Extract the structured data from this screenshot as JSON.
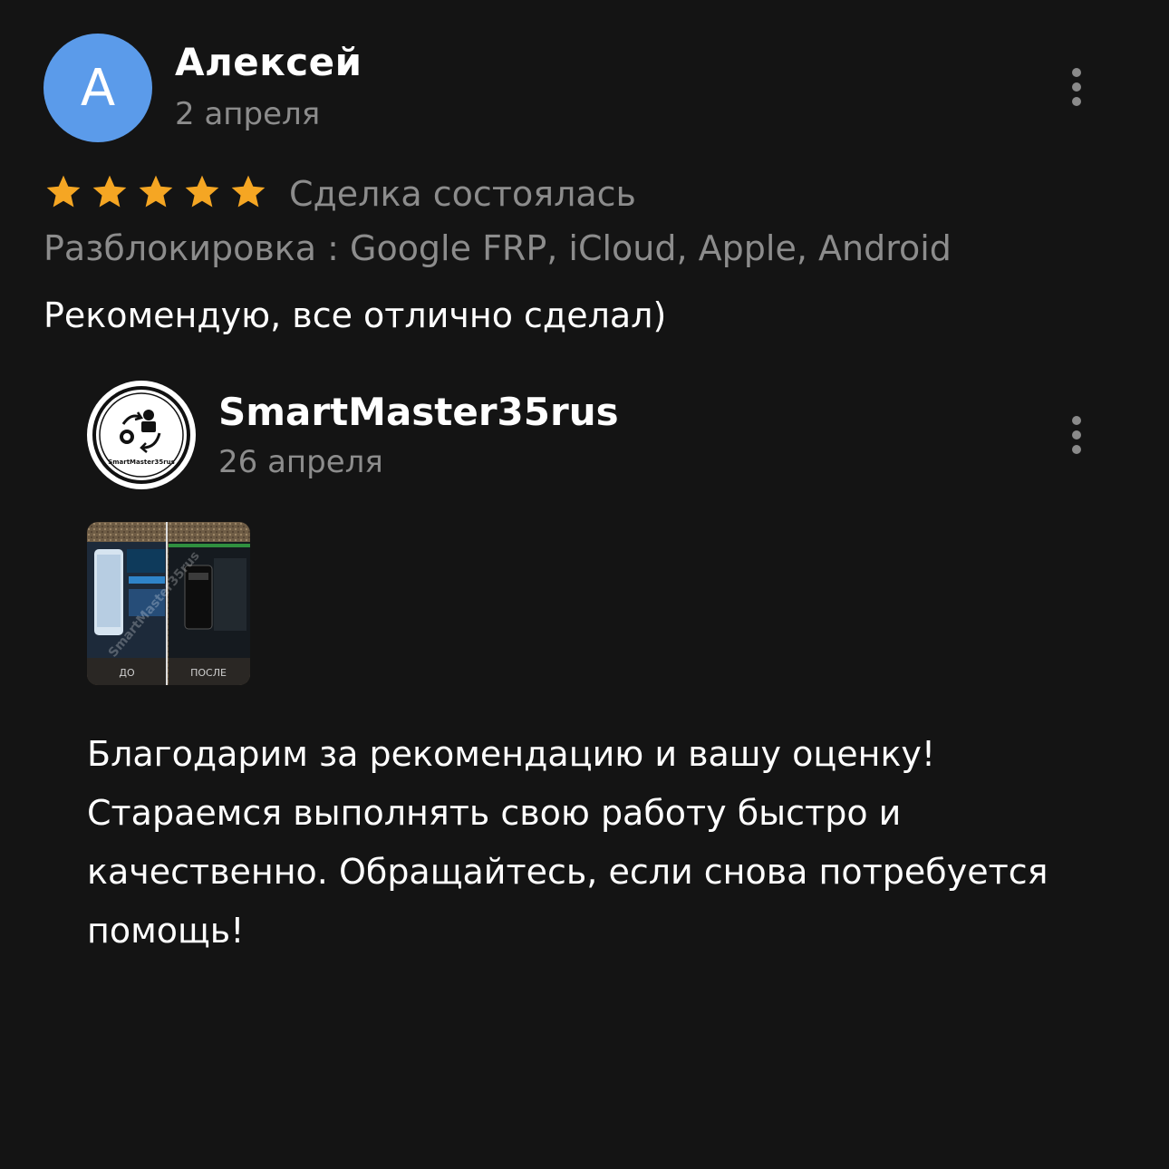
{
  "review": {
    "avatar_letter": "А",
    "author": "Алексей",
    "date": "2 апреля",
    "rating": 5,
    "rating_max": 5,
    "star_color": "#f5a623",
    "deal_status": "Сделка состоялась",
    "service": "Разблокировка : Google FRP, iCloud, Apple, Android",
    "text": "Рекомендую, все отлично сделал)",
    "menu_icon": "more-vertical-icon"
  },
  "reply": {
    "author": "SmartMaster35rus",
    "date": "26 апреля",
    "logo_text": "SmartMaster35rus",
    "photo_captions": [
      "ДО",
      "ПОСЛЕ"
    ],
    "text": "Благодарим за рекомендацию и вашу оценку! Стараемся выполнять свою работу быстро и качественно. Обращайтесь, если снова потребуется помощь!",
    "menu_icon": "more-vertical-icon"
  },
  "colors": {
    "background": "#141414",
    "avatar_bg": "#5b9bea",
    "secondary_text": "#8c8c8c"
  }
}
